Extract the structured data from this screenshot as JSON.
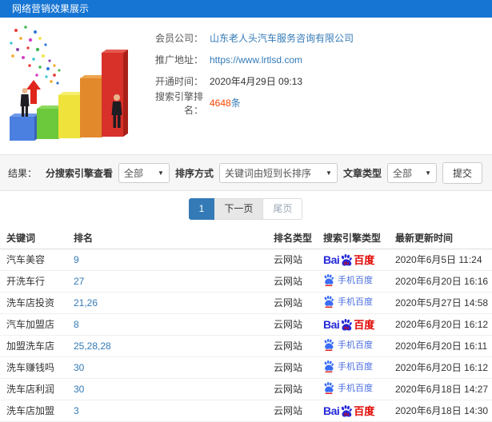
{
  "header": {
    "title": "网络营销效果展示"
  },
  "info": {
    "rows": [
      {
        "label": "会员公司：",
        "value": "山东老人头汽车服务咨询有限公司"
      },
      {
        "label": "推广地址：",
        "value": "https://www.lrtlsd.com"
      },
      {
        "label": "开通时间：",
        "value": "2020年4月29日 09:13"
      },
      {
        "label": "搜索引擎排名：",
        "value": "4648",
        "suffix": "条"
      }
    ]
  },
  "filters": {
    "result_label": "结果：",
    "engine_filter_label": "分搜索引擎查看",
    "engine_filter_value": "全部",
    "sort_label": "排序方式",
    "sort_value": "关键词由短到长排序",
    "article_type_label": "文章类型",
    "article_type_value": "全部",
    "submit_label": "提交"
  },
  "pagination": {
    "current": "1",
    "next_label": "下一页",
    "last_label": "尾页"
  },
  "table": {
    "headers": [
      "关键词",
      "排名",
      "排名类型",
      "搜索引擎类型",
      "最新更新时间"
    ],
    "rows": [
      {
        "keyword": "汽车美容",
        "rank": "9",
        "rank_type": "云网站",
        "engine": "baidu",
        "updated": "2020年6月5日 11:24"
      },
      {
        "keyword": "开洗车行",
        "rank": "27",
        "rank_type": "云网站",
        "engine": "mobile_baidu",
        "updated": "2020年6月20日 16:16"
      },
      {
        "keyword": "洗车店投资",
        "rank": "21,26",
        "rank_type": "云网站",
        "engine": "mobile_baidu",
        "updated": "2020年5月27日 14:58"
      },
      {
        "keyword": "汽车加盟店",
        "rank": "8",
        "rank_type": "云网站",
        "engine": "baidu",
        "updated": "2020年6月20日 16:12"
      },
      {
        "keyword": "加盟洗车店",
        "rank": "25,28,28",
        "rank_type": "云网站",
        "engine": "mobile_baidu",
        "updated": "2020年6月20日 16:11"
      },
      {
        "keyword": "洗车赚钱吗",
        "rank": "30",
        "rank_type": "云网站",
        "engine": "mobile_baidu",
        "updated": "2020年6月20日 16:12"
      },
      {
        "keyword": "洗车店利润",
        "rank": "30",
        "rank_type": "云网站",
        "engine": "mobile_baidu",
        "updated": "2020年6月18日 14:27"
      },
      {
        "keyword": "洗车店加盟",
        "rank": "3",
        "rank_type": "云网站",
        "engine": "baidu",
        "updated": "2020年6月18日 14:30"
      }
    ]
  },
  "engines": {
    "baidu": {
      "bai": "Bai",
      "du": "du",
      "cn": "百度"
    },
    "mobile_baidu": {
      "label": "手机百度"
    }
  },
  "colors": {
    "header_blue": "#1674d2",
    "link_blue": "#337ab7",
    "rank_red": "#f54400",
    "baidu_blue": "#2529d8",
    "baidu_red": "#e10601",
    "mobile_blue": "#4a6ee0"
  }
}
